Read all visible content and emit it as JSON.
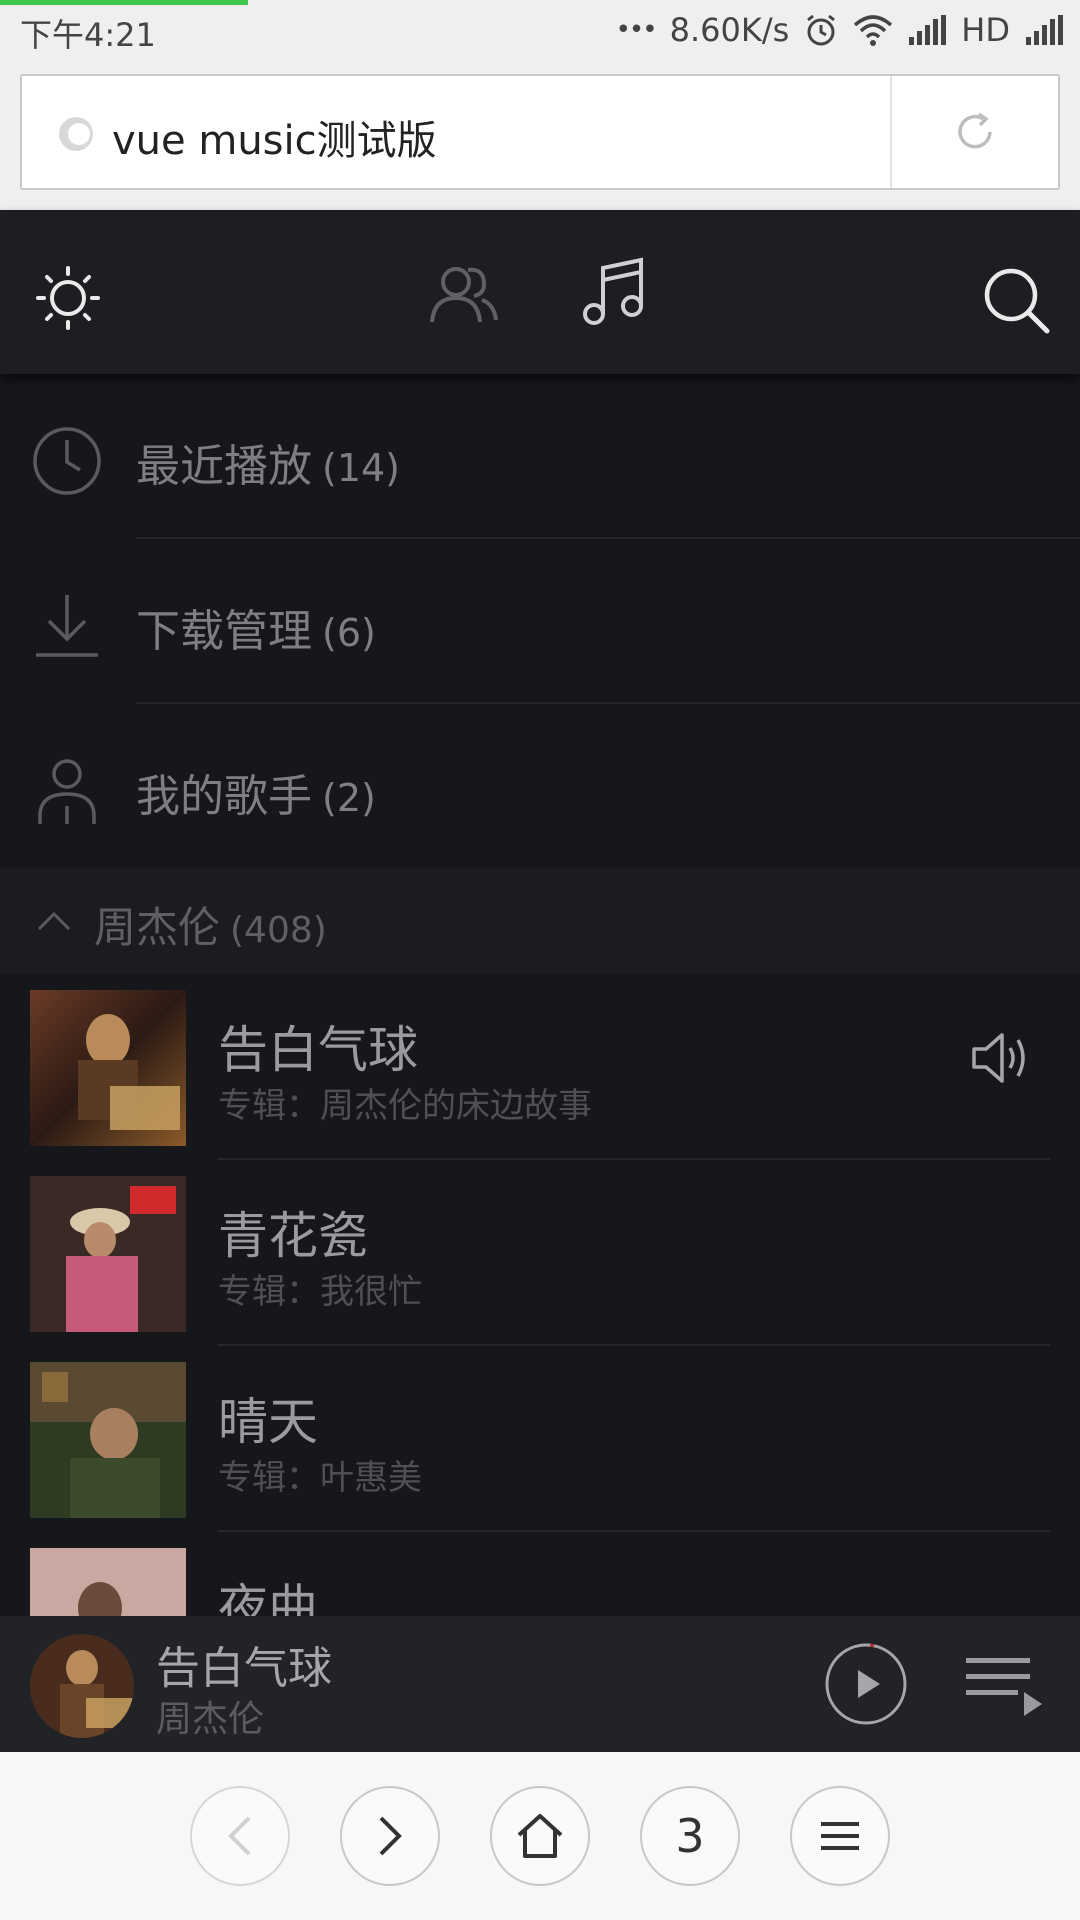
{
  "status_bar": {
    "time": "下午4:21",
    "dots": "•••",
    "network_speed": "8.60K/s",
    "hd_label": "HD",
    "page_load_progress": 0.23
  },
  "address_bar": {
    "url_text": "vue music测试版"
  },
  "header": {
    "icons": [
      "sun-icon",
      "friends-icon",
      "music-note-icon",
      "search-icon"
    ]
  },
  "menu": {
    "items": [
      {
        "label": "最近播放",
        "count": "(14)",
        "icon": "clock-icon"
      },
      {
        "label": "下载管理",
        "count": "(6)",
        "icon": "download-icon"
      },
      {
        "label": "我的歌手",
        "count": "(2)",
        "icon": "person-icon"
      }
    ]
  },
  "group": {
    "title": "周杰伦",
    "count": "(408)"
  },
  "songs": [
    {
      "title": "告白气球",
      "album": "专辑：周杰伦的床边故事",
      "playing": true
    },
    {
      "title": "青花瓷",
      "album": "专辑：我很忙",
      "playing": false
    },
    {
      "title": "晴天",
      "album": "专辑：叶惠美",
      "playing": false
    },
    {
      "title": "夜曲",
      "album": "",
      "playing": false
    }
  ],
  "mini_player": {
    "title": "告白气球",
    "artist": "周杰伦"
  },
  "toolbar": {
    "tabs_count": "3"
  },
  "colors": {
    "progress_green": "#3ec74b",
    "app_background": "#16171b",
    "header_background": "#1d1e22"
  }
}
